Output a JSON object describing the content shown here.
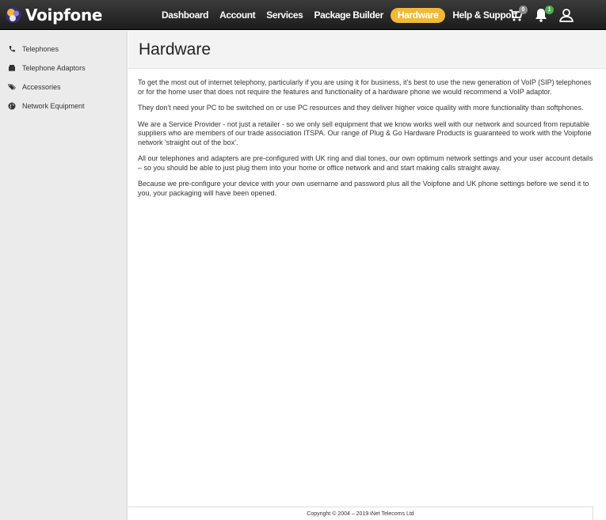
{
  "brand": {
    "name": "Voipfone"
  },
  "nav": {
    "items": [
      {
        "label": "Dashboard"
      },
      {
        "label": "Account"
      },
      {
        "label": "Services"
      },
      {
        "label": "Package Builder"
      },
      {
        "label": "Hardware",
        "active": true
      },
      {
        "label": "Help & Support"
      }
    ],
    "active_color": "#f0b93a"
  },
  "header_icons": {
    "cart": {
      "icon": "cart-icon",
      "count": "0"
    },
    "notifications": {
      "icon": "bell-icon",
      "count": "1"
    },
    "user": {
      "icon": "user-icon"
    }
  },
  "sidebar": {
    "items": [
      {
        "label": "Telephones",
        "icon": "phone-icon"
      },
      {
        "label": "Telephone Adaptors",
        "icon": "adaptor-icon"
      },
      {
        "label": "Accessories",
        "icon": "tags-icon"
      },
      {
        "label": "Network Equipment",
        "icon": "globe-icon"
      }
    ]
  },
  "page": {
    "title": "Hardware",
    "paragraphs": [
      "To get the most out of internet telephony, particularly if you are using it for business, it's best to use the new generation of VoIP (SIP) telephones or for the home user that does not require the features and functionality of a hardware phone we would recommend a VoIP adaptor.",
      "They don't need your PC to be switched on or use PC resources and they deliver higher voice quality with more functionality than softphones.",
      "We are a Service Provider - not just a retailer - so we only sell equipment that we know works well with our network and sourced from reputable suppliers who are members of our trade association ITSPA. Our range of Plug & Go Hardware Products is guaranteed to work with the Voipfone network 'straight out of the box'.",
      "All our telephones and adapters are pre-configured with UK ring and dial tones, our own optimum network settings and your user account details – so you should be able to just plug them into your home or office network and and start making calls straight away.",
      "Because we pre-configure your device with your own username and password plus all the Voipfone and UK phone settings before we send it to you, your packaging will have been opened."
    ]
  },
  "footer": {
    "copyright": "Copyright © 2004 – 2019 iNet Telecoms Ltd"
  }
}
